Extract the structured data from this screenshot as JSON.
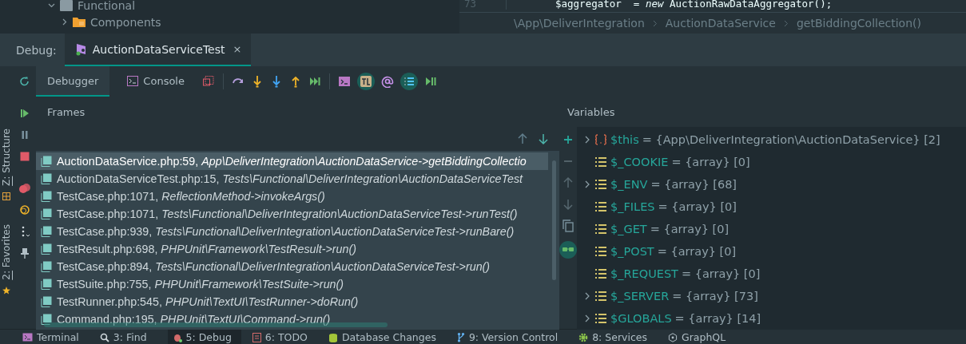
{
  "project_tree": [
    {
      "label": "Functional",
      "expanded": true
    },
    {
      "label": "Components",
      "expanded": false
    }
  ],
  "editor": {
    "line_number": "73",
    "code": "$aggregator  = *new* AuctionRawDataAggregator();",
    "breadcrumbs": [
      "\\App\\DeliverIntegration",
      "AuctionDataService",
      "getBiddingCollection()"
    ]
  },
  "debug_bar": {
    "label": "Debug:",
    "tab": {
      "title": "AuctionDataServiceTest",
      "close": "×"
    }
  },
  "toolbar": {
    "tabs": [
      {
        "label": "Debugger",
        "selected": true
      },
      {
        "label": "Console",
        "selected": false
      }
    ]
  },
  "side_labels": [
    "Z: Structure",
    "2: Favorites"
  ],
  "frames": {
    "title": "Frames",
    "rows": [
      {
        "file": "AuctionDataService.php:59,",
        "method": "App\\DeliverIntegration\\AuctionDataService->getBiddingCollectio",
        "selected": true
      },
      {
        "file": "AuctionDataServiceTest.php:15,",
        "method": "Tests\\Functional\\DeliverIntegration\\AuctionDataServiceTest",
        "selected": false
      },
      {
        "file": "TestCase.php:1071,",
        "method": "ReflectionMethod->invokeArgs()",
        "selected": false
      },
      {
        "file": "TestCase.php:1071,",
        "method": "Tests\\Functional\\DeliverIntegration\\AuctionDataServiceTest->runTest()",
        "selected": false
      },
      {
        "file": "TestCase.php:939,",
        "method": "Tests\\Functional\\DeliverIntegration\\AuctionDataServiceTest->runBare()",
        "selected": false
      },
      {
        "file": "TestResult.php:698,",
        "method": "PHPUnit\\Framework\\TestResult->run()",
        "selected": false
      },
      {
        "file": "TestCase.php:894,",
        "method": "Tests\\Functional\\DeliverIntegration\\AuctionDataServiceTest->run()",
        "selected": false
      },
      {
        "file": "TestSuite.php:755,",
        "method": "PHPUnit\\Framework\\TestSuite->run()",
        "selected": false
      },
      {
        "file": "TestRunner.php:545,",
        "method": "PHPUnit\\TextUI\\TestRunner->doRun()",
        "selected": false
      },
      {
        "file": "Command.php:195,",
        "method": "PHPUnit\\TextUI\\Command->run()",
        "selected": false
      }
    ]
  },
  "variables": {
    "title": "Variables",
    "rows": [
      {
        "kind": "object",
        "expandable": true,
        "name": "$this",
        "value": "= {App\\DeliverIntegration\\AuctionDataService} [2]"
      },
      {
        "kind": "array",
        "expandable": false,
        "name": "$_COOKIE",
        "value": "= {array} [0]"
      },
      {
        "kind": "array",
        "expandable": true,
        "name": "$_ENV",
        "value": "= {array} [68]"
      },
      {
        "kind": "array",
        "expandable": false,
        "name": "$_FILES",
        "value": "= {array} [0]"
      },
      {
        "kind": "array",
        "expandable": false,
        "name": "$_GET",
        "value": "= {array} [0]"
      },
      {
        "kind": "array",
        "expandable": false,
        "name": "$_POST",
        "value": "= {array} [0]"
      },
      {
        "kind": "array",
        "expandable": false,
        "name": "$_REQUEST",
        "value": "= {array} [0]"
      },
      {
        "kind": "array",
        "expandable": true,
        "name": "$_SERVER",
        "value": "= {array} [73]"
      },
      {
        "kind": "array",
        "expandable": true,
        "name": "$GLOBALS",
        "value": "= {array} [14]"
      }
    ]
  },
  "status_bar": [
    {
      "label": "Terminal",
      "selected": false
    },
    {
      "label": "3: Find",
      "selected": false
    },
    {
      "label": "5: Debug",
      "selected": true
    },
    {
      "label": "6: TODO",
      "selected": false
    },
    {
      "label": "Database Changes",
      "selected": false
    },
    {
      "label": "9: Version Control",
      "selected": false
    },
    {
      "label": "8: Services",
      "selected": false
    },
    {
      "label": "GraphQL",
      "selected": false
    }
  ]
}
